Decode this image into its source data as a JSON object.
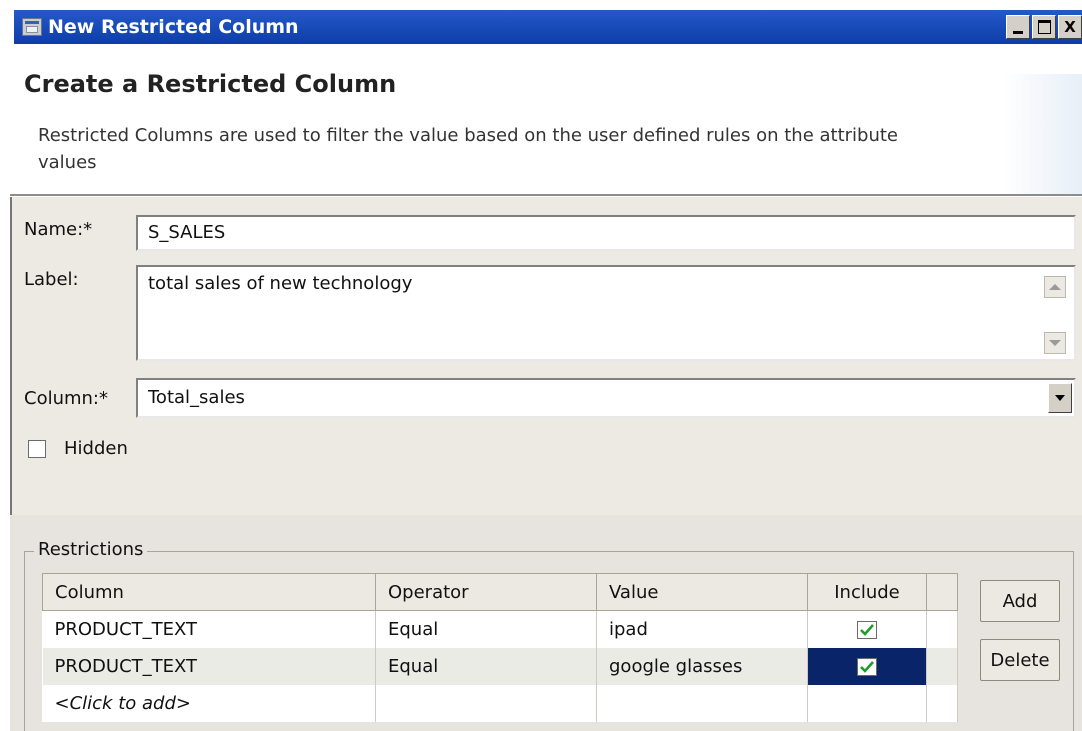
{
  "window": {
    "title": "New Restricted Column",
    "controls": {
      "minimize": "_",
      "maximize": "□",
      "close": "X"
    }
  },
  "header": {
    "heading": "Create a Restricted Column",
    "description": "Restricted Columns are used to filter the value based on the user defined rules on the attribute values"
  },
  "form": {
    "name_label": "Name:*",
    "name_value": "S_SALES",
    "label_label": "Label:",
    "label_value": "total sales of new technology",
    "column_label": "Column:*",
    "column_value": "Total_sales",
    "hidden_label": "Hidden",
    "hidden_checked": false
  },
  "restrictions": {
    "legend": "Restrictions",
    "columns": [
      "Column",
      "Operator",
      "Value",
      "Include"
    ],
    "rows": [
      {
        "column": "PRODUCT_TEXT",
        "operator": "Equal",
        "value": "ipad",
        "include": true
      },
      {
        "column": "PRODUCT_TEXT",
        "operator": "Equal",
        "value": "google glasses",
        "include": true
      }
    ],
    "add_row_placeholder": "<Click to add>",
    "add_button": "Add",
    "delete_button": "Delete"
  },
  "colors": {
    "titlebar": "#0d3ea8",
    "selection": "#0a246a",
    "check": "#1b9e2a"
  },
  "icons": [
    "window-app-icon",
    "minimize-icon",
    "maximize-icon",
    "close-icon",
    "scroll-up-icon",
    "scroll-down-icon",
    "dropdown-arrow-icon",
    "checkmark-icon"
  ]
}
